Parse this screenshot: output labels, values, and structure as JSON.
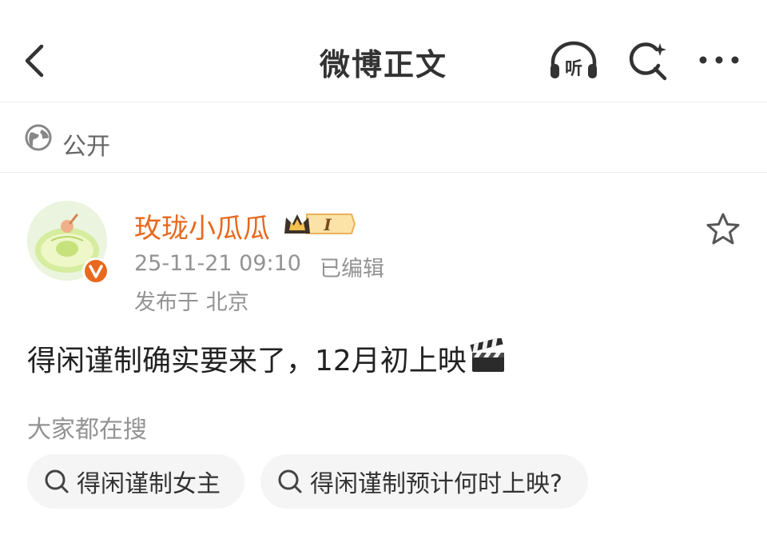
{
  "header": {
    "title": "微博正文",
    "back_icon": "chevron-left-icon",
    "listen_label": "听",
    "icons": [
      "headphones-icon",
      "search-sparkle-icon",
      "more-icon"
    ]
  },
  "visibility": {
    "icon": "globe-icon",
    "label": "公开"
  },
  "post": {
    "author": {
      "name": "玫珑小瓜瓜",
      "vip_level": "I",
      "name_color": "#e8691e",
      "verified_color": "#e8691e"
    },
    "time": "25-11-21 09:10",
    "edited": "已编辑",
    "location": "发布于 北京",
    "text": "得闲谨制确实要来了，12月初上映",
    "emoji": "clapper-board-icon"
  },
  "trending": {
    "title": "大家都在搜",
    "items": [
      {
        "label": "得闲谨制女主"
      },
      {
        "label": "得闲谨制预计何时上映?"
      }
    ]
  }
}
